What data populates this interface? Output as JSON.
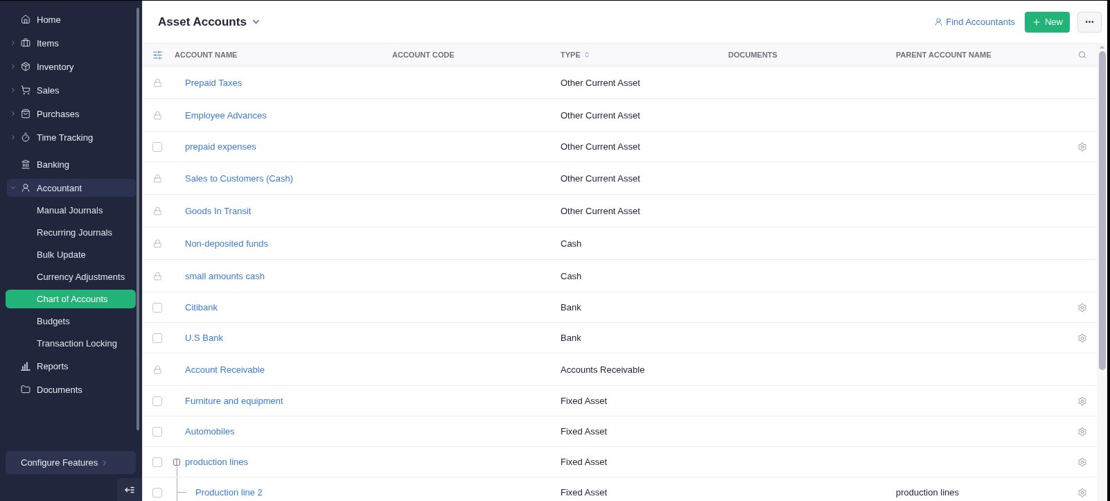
{
  "sidebar": {
    "groups": [
      {
        "items": [
          {
            "label": "Home",
            "selected": false
          },
          {
            "label": "Items",
            "expanded": false,
            "selected": false
          },
          {
            "label": "Inventory",
            "expanded": false,
            "selected": false
          },
          {
            "label": "Sales",
            "expanded": false,
            "selected": false
          },
          {
            "label": "Purchases",
            "expanded": false,
            "selected": false
          },
          {
            "label": "Time Tracking",
            "expanded": false,
            "selected": false
          }
        ]
      },
      {
        "items": [
          {
            "label": "Banking",
            "selected": false
          },
          {
            "label": "Accountant",
            "expanded": true,
            "selected": true,
            "children": [
              {
                "label": "Manual Journals",
                "selected": false
              },
              {
                "label": "Recurring Journals",
                "selected": false
              },
              {
                "label": "Bulk Update",
                "selected": false
              },
              {
                "label": "Currency Adjustments",
                "selected": false
              },
              {
                "label": "Chart of Accounts",
                "selected": true
              },
              {
                "label": "Budgets",
                "selected": false
              },
              {
                "label": "Transaction Locking",
                "selected": false
              }
            ]
          },
          {
            "label": "Reports",
            "selected": false
          },
          {
            "label": "Documents",
            "selected": false
          }
        ]
      }
    ],
    "footer": {
      "label": "Configure Features"
    }
  },
  "header": {
    "title": "Asset Accounts",
    "find_link": "Find Accountants",
    "new_button": "New"
  },
  "table": {
    "columns": [
      {
        "label": "ACCOUNT NAME"
      },
      {
        "label": "ACCOUNT CODE"
      },
      {
        "label": "TYPE",
        "sortable": true
      },
      {
        "label": "DOCUMENTS"
      },
      {
        "label": "PARENT ACCOUNT NAME"
      }
    ],
    "rows": [
      {
        "kind": "locked",
        "name": "Prepaid Taxes",
        "type": "Other Current Asset"
      },
      {
        "kind": "locked",
        "name": "Employee Advances",
        "type": "Other Current Asset"
      },
      {
        "kind": "editable",
        "checked": false,
        "name": "prepaid expenses",
        "type": "Other Current Asset"
      },
      {
        "kind": "locked",
        "name": "Sales to Customers (Cash)",
        "type": "Other Current Asset"
      },
      {
        "kind": "locked",
        "name": "Goods In Transit",
        "type": "Other Current Asset"
      },
      {
        "kind": "locked",
        "name": "Non-deposited funds",
        "type": "Cash"
      },
      {
        "kind": "locked",
        "name": "small amounts cash",
        "type": "Cash"
      },
      {
        "kind": "editable",
        "checked": false,
        "name": "Citibank",
        "type": "Bank"
      },
      {
        "kind": "editable",
        "checked": false,
        "name": "U.S Bank",
        "type": "Bank"
      },
      {
        "kind": "locked",
        "name": "Account Receivable",
        "type": "Accounts Receivable"
      },
      {
        "kind": "editable",
        "checked": false,
        "name": "Furniture and equipment",
        "type": "Fixed Asset"
      },
      {
        "kind": "editable",
        "checked": false,
        "name": "Automobiles",
        "type": "Fixed Asset"
      },
      {
        "kind": "editable",
        "checked": false,
        "name": "production lines",
        "type": "Fixed Asset",
        "expanded": true,
        "children": [
          {
            "kind": "editable",
            "checked": false,
            "name": "Production line 2",
            "type": "Fixed Asset",
            "parent": "production lines"
          }
        ]
      }
    ]
  }
}
